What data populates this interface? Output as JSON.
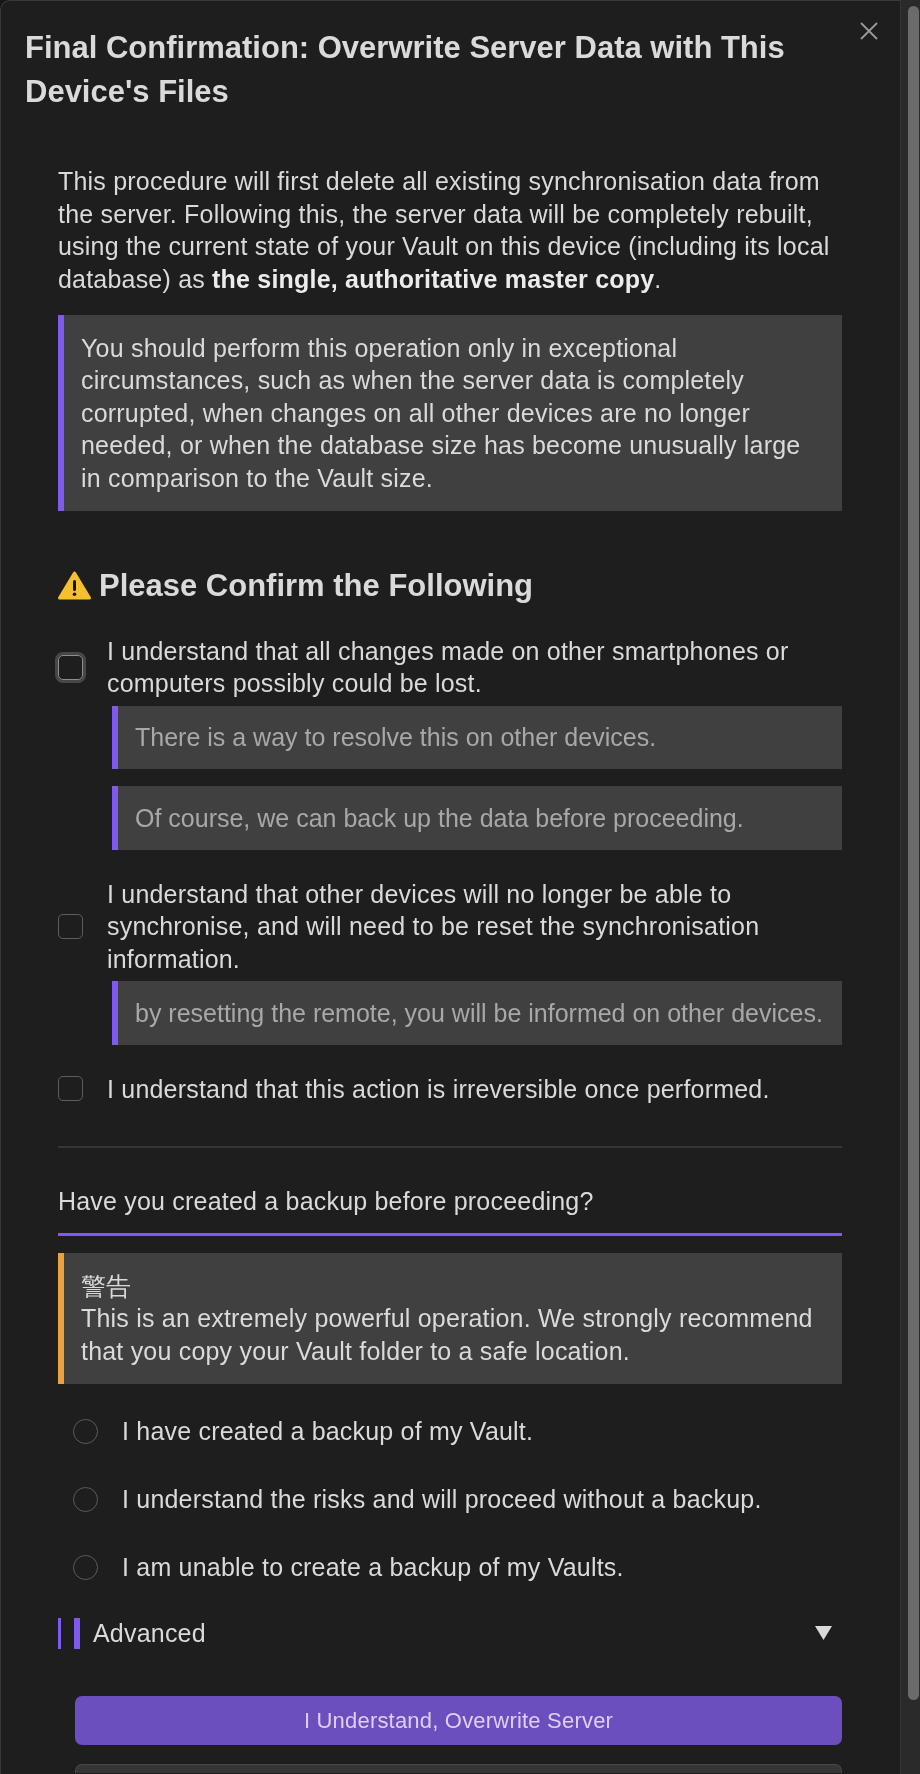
{
  "dialog": {
    "title": "Final Confirmation: Overwrite Server Data with This Device's Files"
  },
  "intro": "This procedure will first delete all existing synchronisation data from the server. Following this, the server data will be completely rebuilt, using the current state of your Vault on this device (including its local database) as **the single, authoritative master copy**.",
  "notice": {
    "kind": "info",
    "text": "You should perform this operation only in exceptional circumstances, such as when the server data is completely corrupted, when changes on all other devices are no longer needed, or when the database size has become unusually large in comparison to the Vault size."
  },
  "confirmations": {
    "heading": "Please Confirm the Following",
    "items": [
      {
        "label": "I understand that all changes made on other smartphones or computers possibly could be lost.",
        "checked": false,
        "focused": true,
        "notes": [
          "There is a way to resolve this on other devices.",
          "Of course, we can back up the data before proceeding."
        ]
      },
      {
        "label": "I understand that other devices will no longer be able to synchronise, and will need to be reset the synchronisation information.",
        "checked": false,
        "focused": false,
        "notes": [
          "by resetting the remote, you will be informed on other devices."
        ]
      },
      {
        "label": "I understand that this action is irreversible once performed.",
        "checked": false,
        "focused": false
      }
    ]
  },
  "backup": {
    "question": "Have you created a backup before proceeding?",
    "warning": {
      "kind": "warning",
      "title": "警告",
      "text": "This is an extremely powerful operation. We strongly recommend that you copy your Vault folder to a safe location."
    },
    "options": [
      {
        "label": "I have created a backup of my Vault.",
        "selected": false
      },
      {
        "label": "I understand the risks and will proceed without a backup.",
        "selected": false
      },
      {
        "label": "I am unable to create a backup of my Vaults.",
        "selected": false
      }
    ]
  },
  "advanced": {
    "label": "Advanced",
    "expanded": false
  },
  "buttons": [
    {
      "kind": "primary",
      "label": "I Understand, Overwrite Server"
    },
    {
      "kind": "secondary"
    }
  ]
}
